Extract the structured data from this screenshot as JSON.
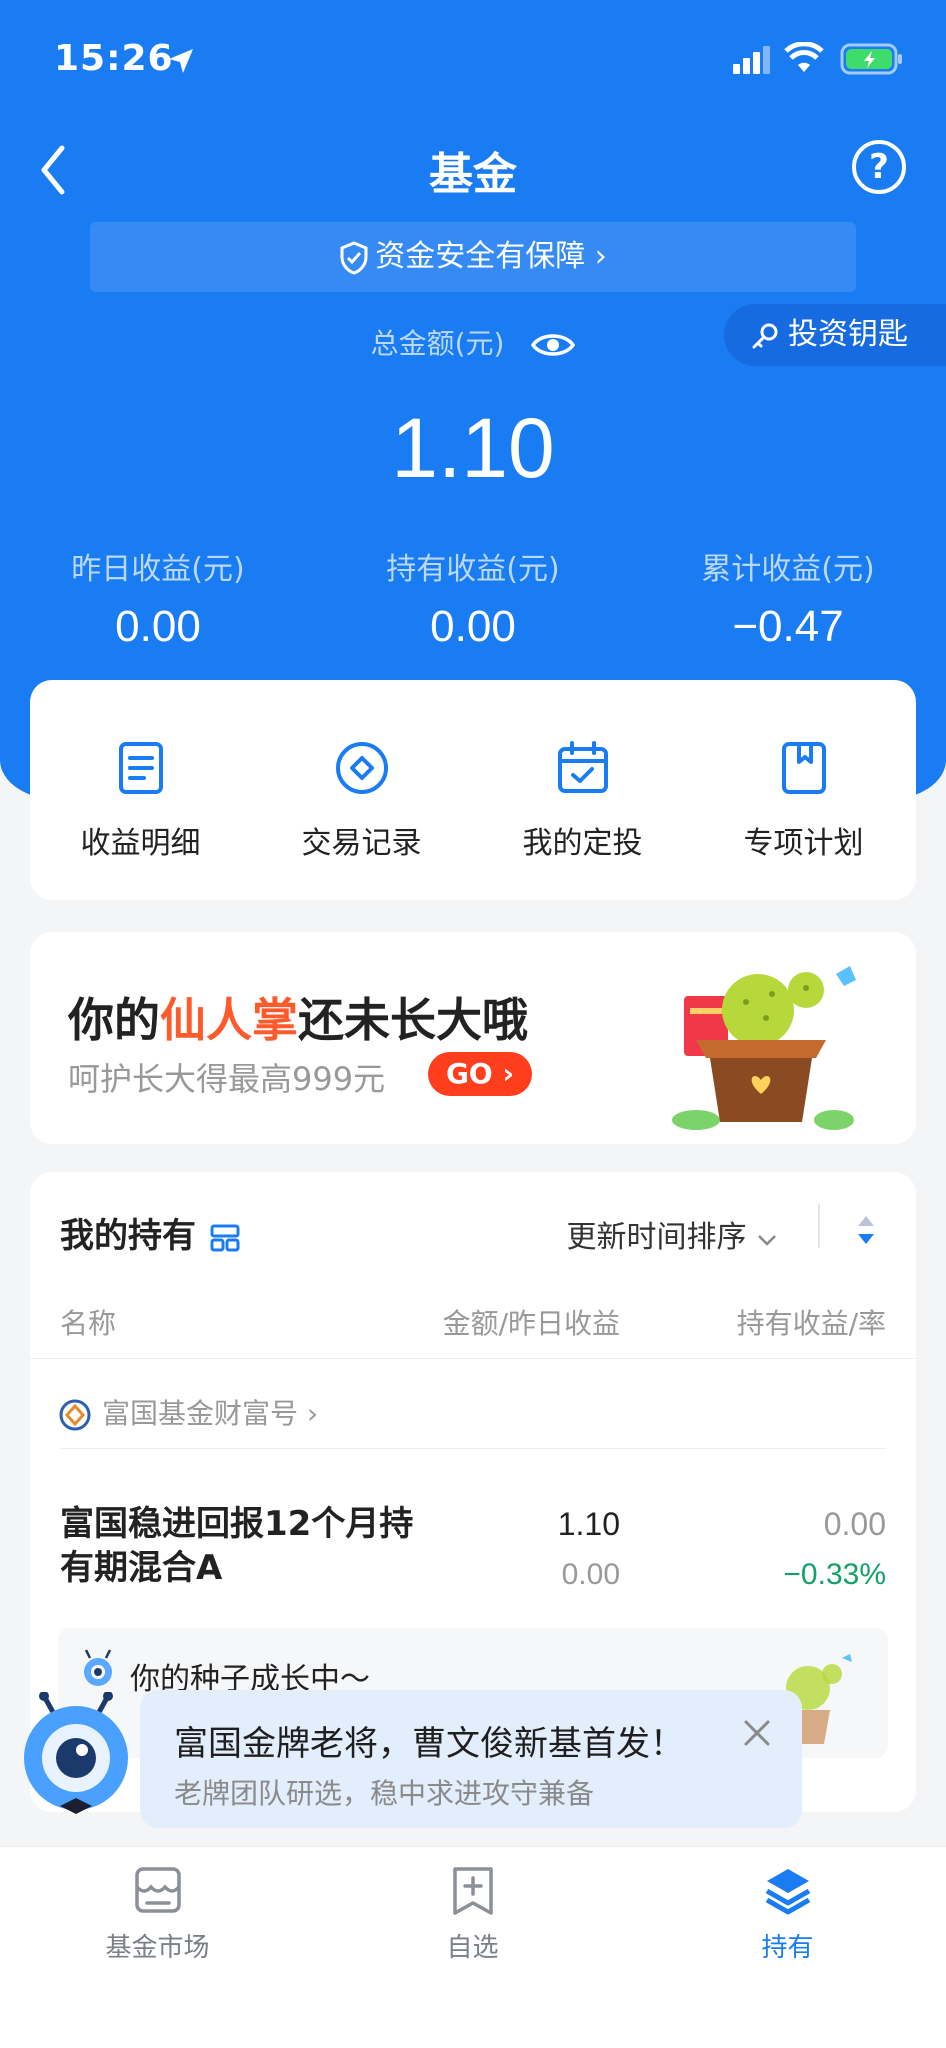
{
  "status_bar": {
    "time": "15:26"
  },
  "header": {
    "title": "基金",
    "help_label": "?"
  },
  "safety_banner": {
    "text": "资金安全有保障",
    "chevron": "›"
  },
  "invest_key": {
    "label": "投资钥匙"
  },
  "summary": {
    "total_label": "总金额(元)",
    "total_value": "1.10",
    "stats": [
      {
        "label": "昨日收益(元)",
        "value": "0.00"
      },
      {
        "label": "持有收益(元)",
        "value": "0.00"
      },
      {
        "label": "累计收益(元)",
        "value": "−0.47"
      }
    ]
  },
  "quick_actions": [
    {
      "label": "收益明细",
      "icon": "document-icon"
    },
    {
      "label": "交易记录",
      "icon": "diamond-circle-icon"
    },
    {
      "label": "我的定投",
      "icon": "calendar-check-icon"
    },
    {
      "label": "专项计划",
      "icon": "bookmark-book-icon"
    }
  ],
  "promo": {
    "title_pre": "你的",
    "title_highlight": "仙人掌",
    "title_post": "还未长大哦",
    "subtitle": "呵护长大得最高999元",
    "go_label": "GO"
  },
  "holdings": {
    "title": "我的持有",
    "sort_label": "更新时间排序",
    "columns": {
      "name": "名称",
      "amount": "金额/昨日收益",
      "profit": "持有收益/率"
    },
    "company": "富国基金财富号",
    "fund": {
      "name": "富国稳进回报12个月持有期混合A",
      "amount": "1.10",
      "yesterday": "0.00",
      "hold_profit": "0.00",
      "hold_rate": "−0.33%"
    },
    "seed_text": "你的种子成长中～"
  },
  "toast": {
    "title": "富国金牌老将，曹文俊新基首发！",
    "subtitle": "老牌团队研选，稳中求进攻守兼备"
  },
  "tabbar": [
    {
      "label": "基金市场",
      "icon": "storefront-icon",
      "active": false
    },
    {
      "label": "自选",
      "icon": "add-bookmark-icon",
      "active": false
    },
    {
      "label": "持有",
      "icon": "layers-icon",
      "active": true
    }
  ],
  "colors": {
    "primary": "#1a7cf2",
    "negative": "#14a06a",
    "go": "#ff3e1e",
    "highlight": "#ff5a2b"
  }
}
